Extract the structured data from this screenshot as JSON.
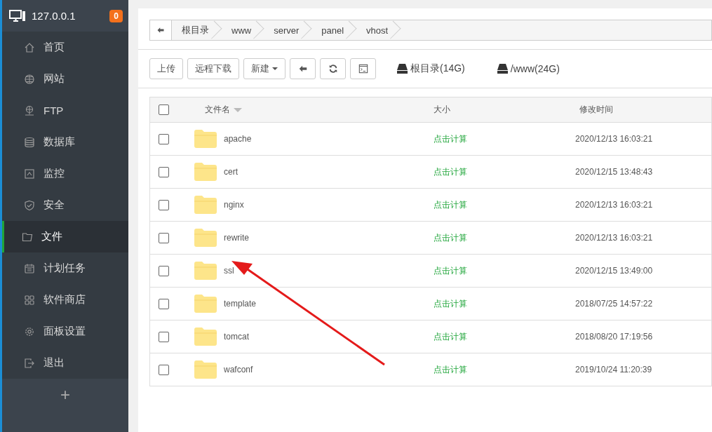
{
  "sidebar": {
    "host": "127.0.0.1",
    "badge": "0",
    "items": [
      {
        "label": "首页",
        "selected": false
      },
      {
        "label": "网站",
        "selected": false
      },
      {
        "label": "FTP",
        "selected": false
      },
      {
        "label": "数据库",
        "selected": false
      },
      {
        "label": "监控",
        "selected": false
      },
      {
        "label": "安全",
        "selected": false
      },
      {
        "label": "文件",
        "selected": true
      },
      {
        "label": "计划任务",
        "selected": false
      },
      {
        "label": "软件商店",
        "selected": false
      },
      {
        "label": "面板设置",
        "selected": false
      },
      {
        "label": "退出",
        "selected": false
      }
    ],
    "add_button": "+"
  },
  "breadcrumb": [
    "根目录",
    "www",
    "server",
    "panel",
    "vhost"
  ],
  "toolbar": {
    "buttons": [
      {
        "kind": "text",
        "label": "上传"
      },
      {
        "kind": "text",
        "label": "远程下载"
      },
      {
        "kind": "dropdown",
        "label": "新建"
      },
      {
        "kind": "back"
      },
      {
        "kind": "refresh"
      },
      {
        "kind": "terminal"
      }
    ],
    "disks": [
      "根目录(14G)",
      "/www(24G)"
    ]
  },
  "table": {
    "select_all": {
      "checked": false
    },
    "columns": [
      "文件名",
      "大小",
      "修改时间"
    ],
    "rows": [
      {
        "name": "apache",
        "size": "点击计算",
        "modified": "2020/12/13 16:03:21",
        "checked": false
      },
      {
        "name": "cert",
        "size": "点击计算",
        "modified": "2020/12/15 13:48:43",
        "checked": false
      },
      {
        "name": "nginx",
        "size": "点击计算",
        "modified": "2020/12/13 16:03:21",
        "checked": false
      },
      {
        "name": "rewrite",
        "size": "点击计算",
        "modified": "2020/12/13 16:03:21",
        "checked": false
      },
      {
        "name": "ssl",
        "size": "点击计算",
        "modified": "2020/12/15 13:49:00",
        "checked": false
      },
      {
        "name": "template",
        "size": "点击计算",
        "modified": "2018/07/25 14:57:22",
        "checked": false
      },
      {
        "name": "tomcat",
        "size": "点击计算",
        "modified": "2018/08/20 17:19:56",
        "checked": false
      },
      {
        "name": "wafconf",
        "size": "点击计算",
        "modified": "2019/10/24 11:20:39",
        "checked": false
      }
    ]
  }
}
